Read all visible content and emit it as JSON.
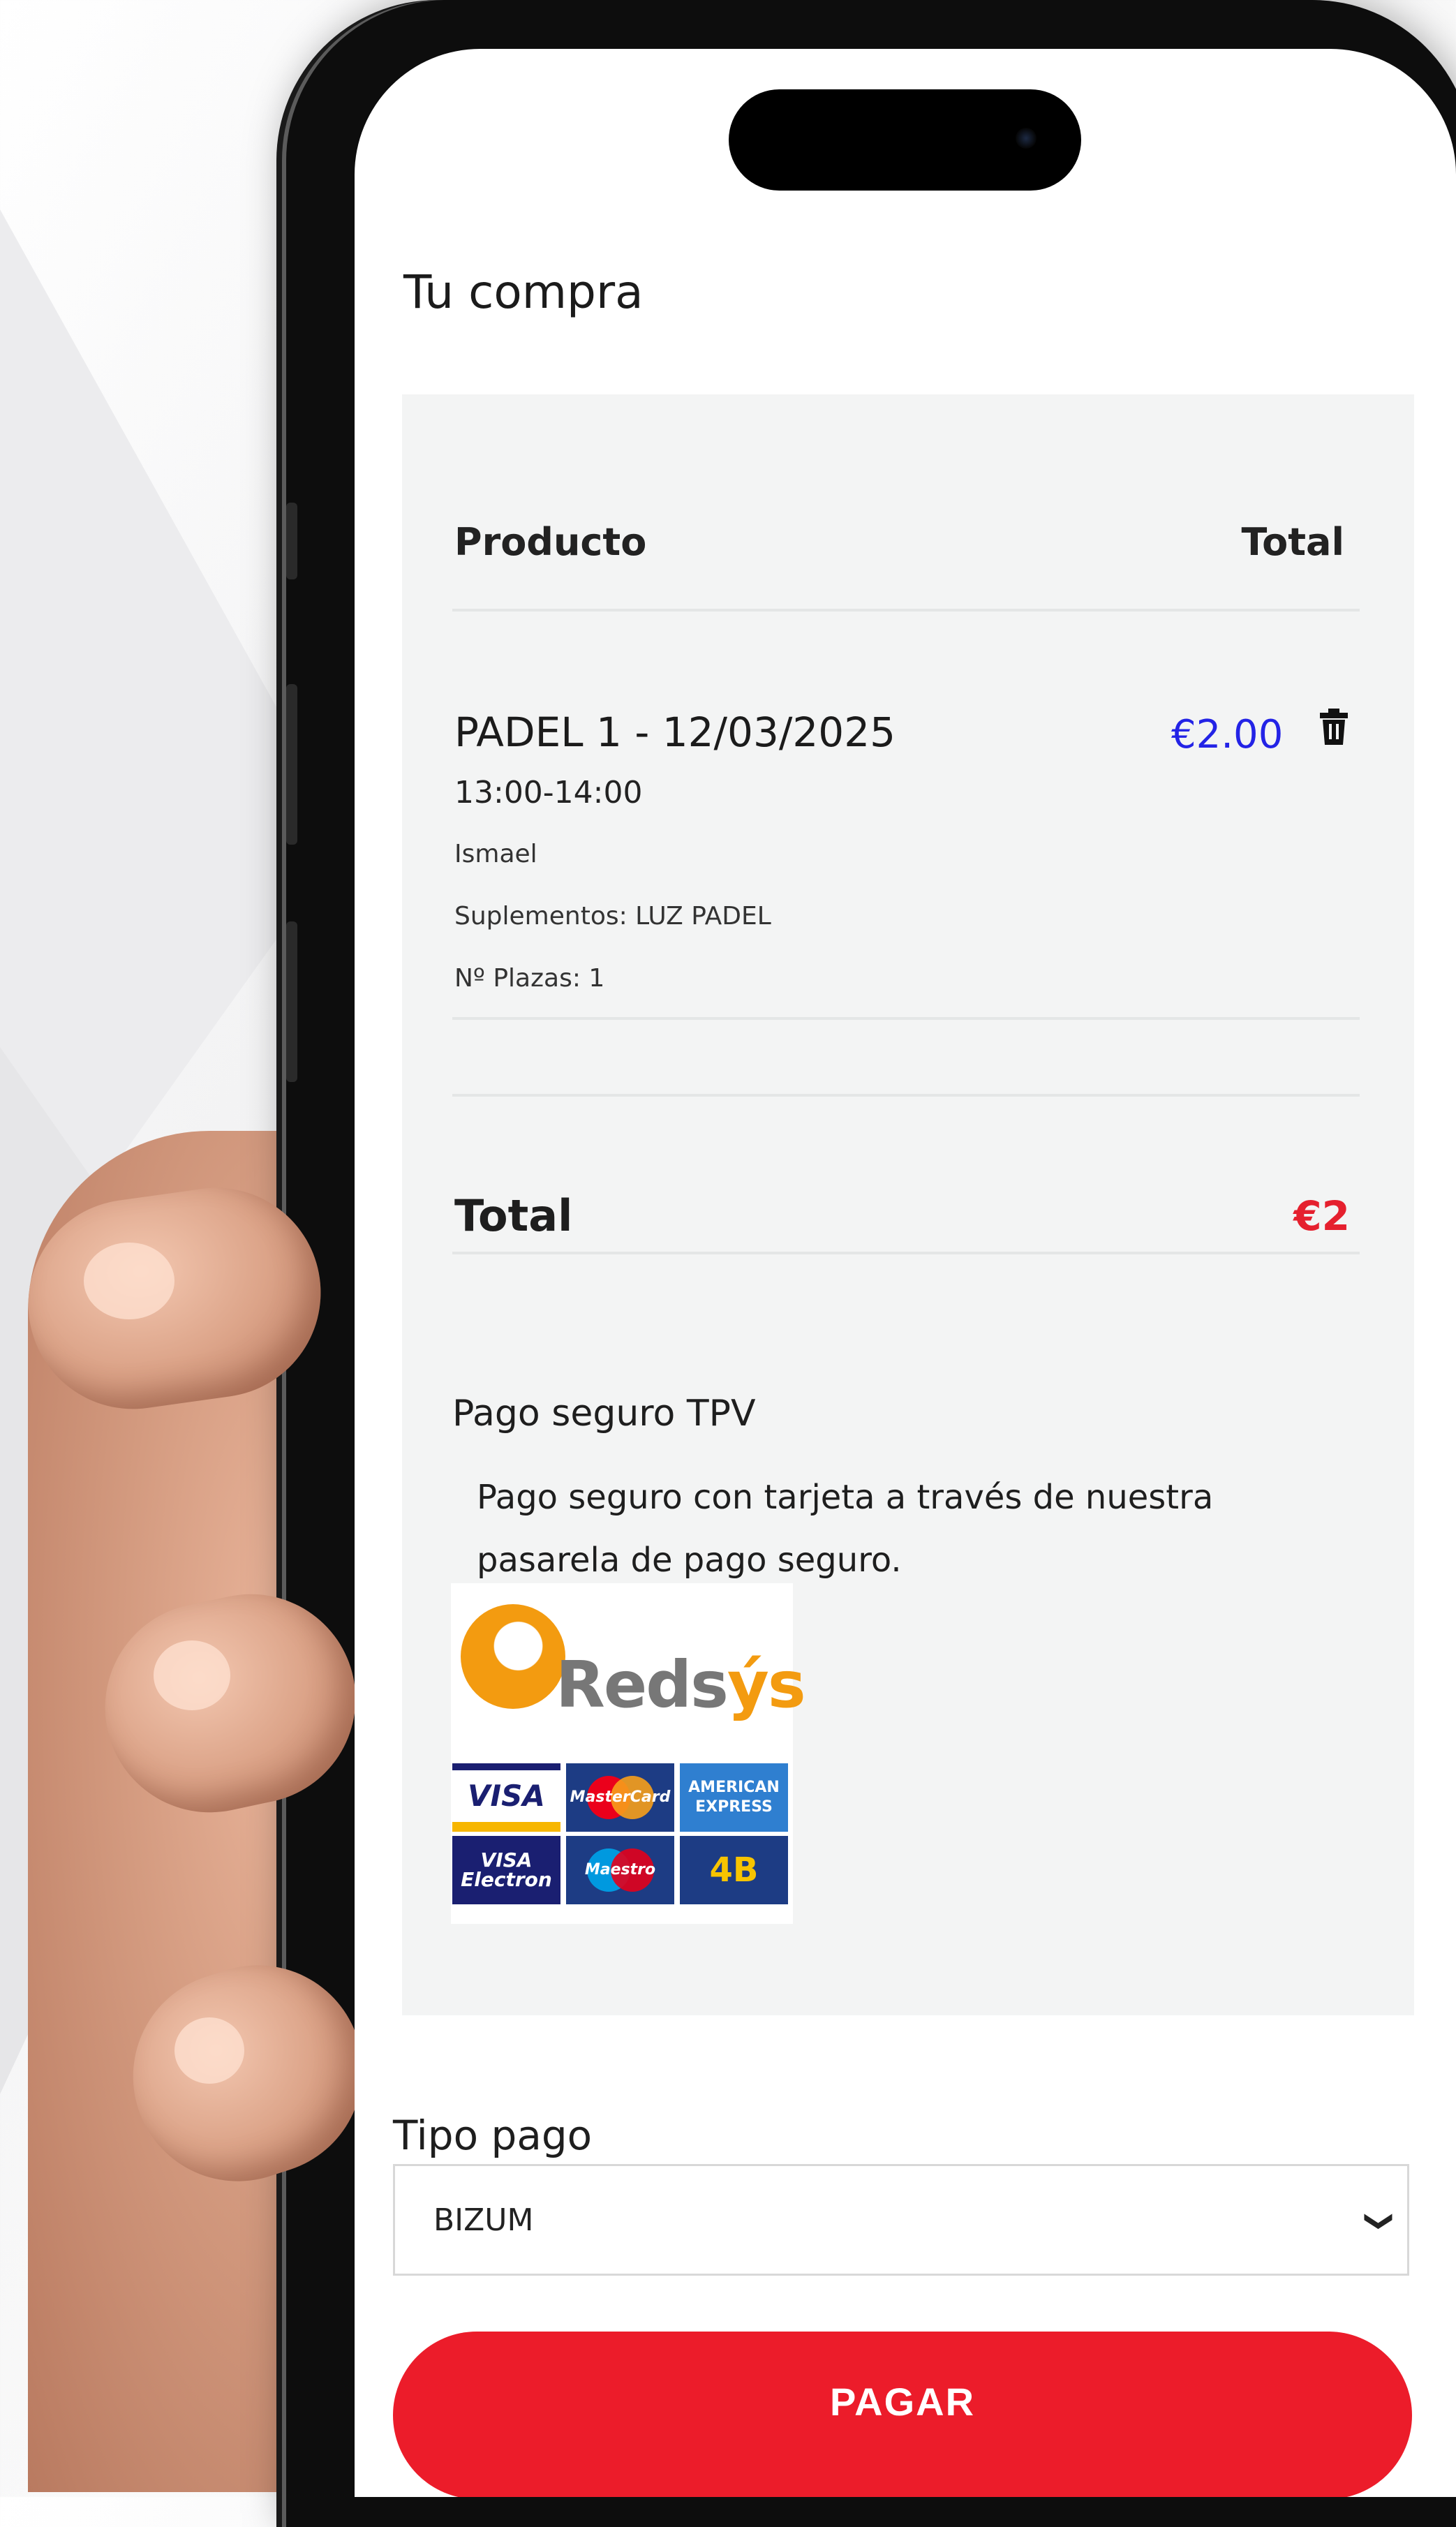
{
  "page": {
    "title": "Tu compra"
  },
  "table": {
    "col_product": "Producto",
    "col_total": "Total"
  },
  "item": {
    "name": "PADEL 1 - 12/03/2025",
    "time": "13:00-14:00",
    "user": "Ismael",
    "supplements": "Suplementos: LUZ PADEL",
    "seats": "Nº Plazas: 1",
    "price": "€2.00"
  },
  "summary": {
    "total_label": "Total",
    "total_value": "€2"
  },
  "payment": {
    "method_title": "Pago seguro TPV",
    "method_description": "Pago seguro con tarjeta a través de nuestra pasarela de pago seguro.",
    "gateway_logo": "Redsýs",
    "cards": [
      "VISA",
      "MasterCard",
      "AMERICAN EXPRESS",
      "VISA Electron",
      "Maestro",
      "4B"
    ]
  },
  "payment_type": {
    "label": "Tipo pago",
    "selected": "BIZUM"
  },
  "submit": {
    "label": "PAGAR"
  },
  "colors": {
    "accent_red": "#ec1c2a",
    "price_blue": "#2323e6",
    "card_bg": "#f3f4f4"
  }
}
